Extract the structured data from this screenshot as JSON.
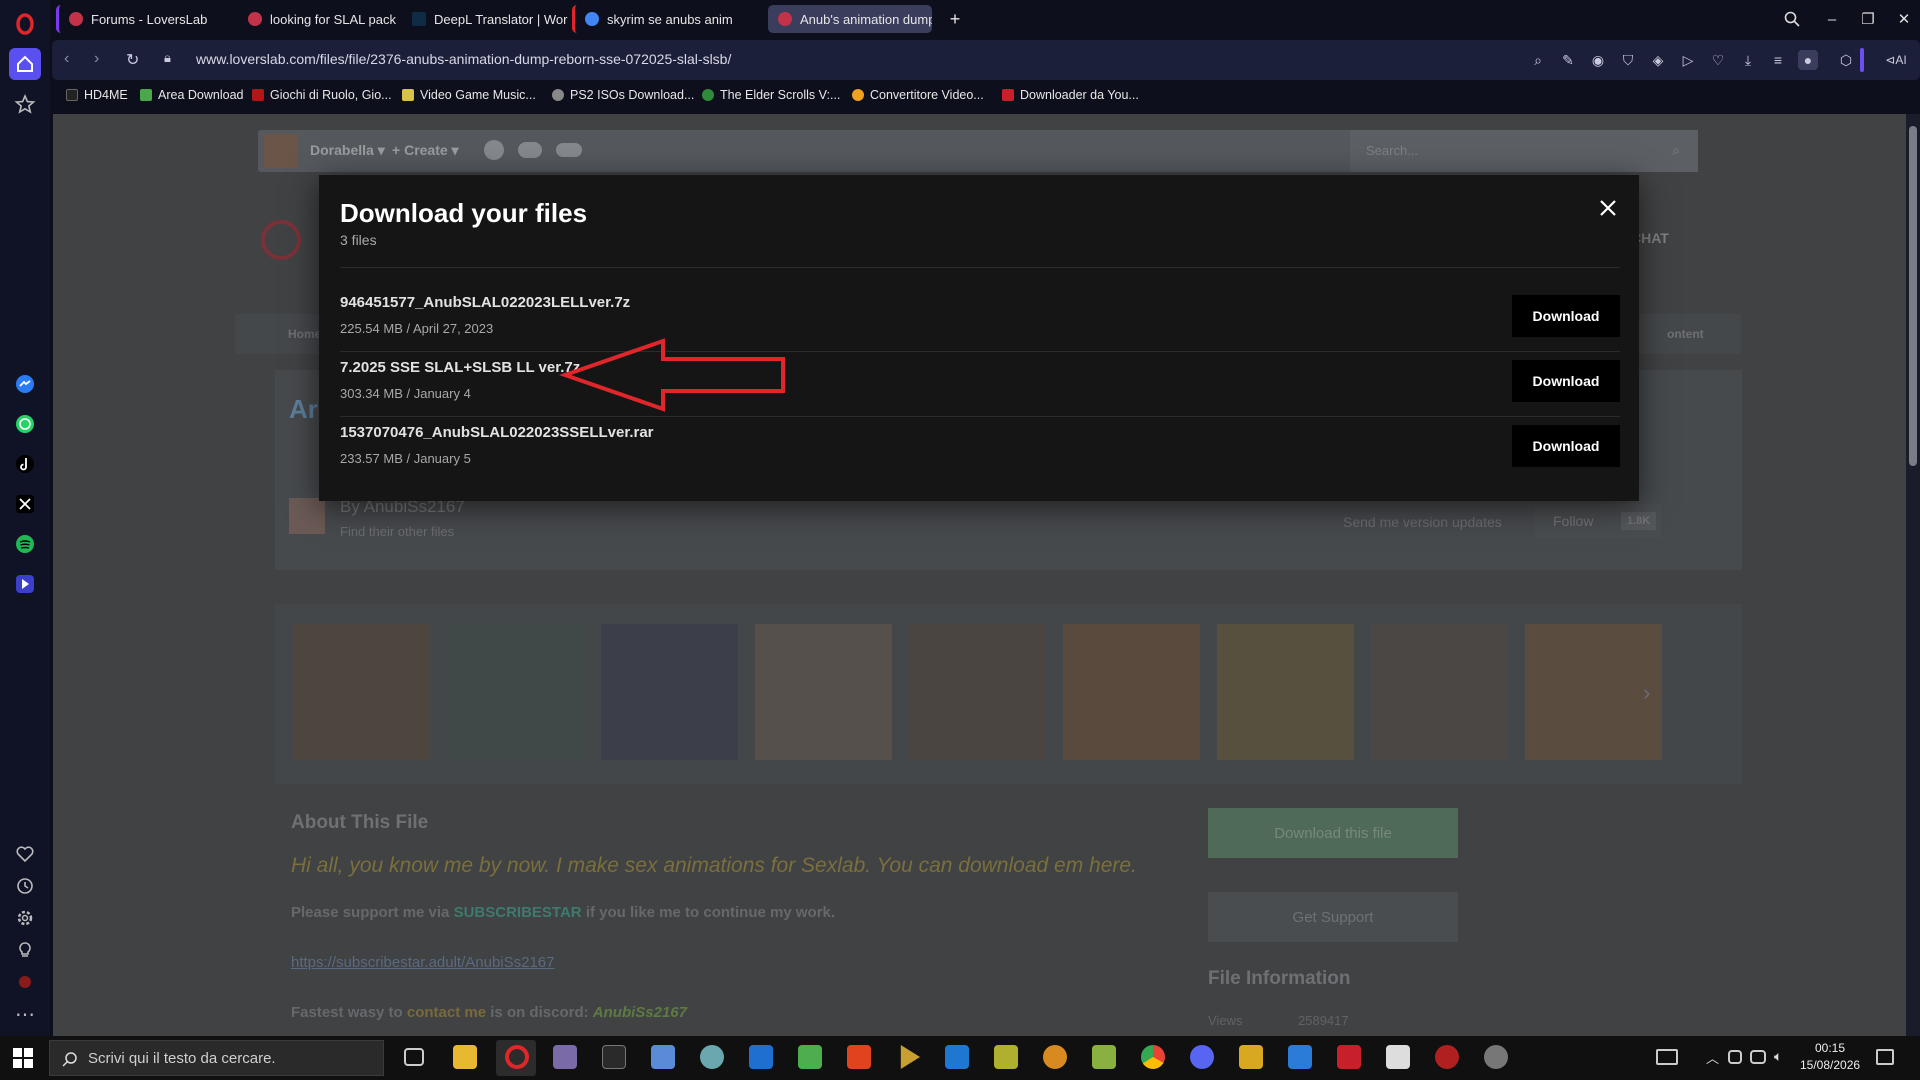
{
  "browser": {
    "tabs": [
      {
        "label": "Forums - LoversLab",
        "active": false
      },
      {
        "label": "looking for SLAL pack con",
        "active": false
      },
      {
        "label": "DeepL Translator | World's",
        "active": false
      },
      {
        "label": "skyrim se anubs animation",
        "active": false
      },
      {
        "label": "Anub's animation dump (",
        "active": true
      }
    ],
    "new_tab": "+",
    "url": "www.loverslab.com/files/file/2376-anubs-animation-dump-reborn-sse-072025-slal-slsb/",
    "ai_label": "AI",
    "bookmarks": [
      "HD4ME",
      "Area Download",
      "Giochi di Ruolo, Gio...",
      "Video Game Music...",
      "PS2 ISOs Download...",
      "The Elder Scrolls V:...",
      "Convertitore Video...",
      "Downloader da You..."
    ]
  },
  "site": {
    "user": "Dorabella",
    "create_label": "Create",
    "search_placeholder": "Search...",
    "chat_label": "CHAT",
    "breadcrumb_home": "Home",
    "content_label": "ontent",
    "title_fragment": "Ar",
    "author": "By AnubiSs2167",
    "author_sub": "Find their other files",
    "version_updates": "Send me version updates",
    "follow_label": "Follow",
    "follow_count": "1.8K",
    "about_title": "About This File",
    "about_lead": "Hi all, you know me by now. I make sex animations for Sexlab. You can download em here.",
    "support_pre": "Please support me via",
    "support_link": "SUBSCRIBESTAR",
    "support_post": "if you like me to continue my work.",
    "subscribestar_url": "https://subscribestar.adult/AnubiSs2167",
    "discord_pre": "Fastest wasy to",
    "discord_link": "contact me",
    "discord_mid": "is on discord:",
    "discord_handle": "AnubiSs2167",
    "download_this_file": "Download this file",
    "get_support": "Get Support",
    "file_info_title": "File Information",
    "views_label": "Views",
    "views_value": "2589417"
  },
  "modal": {
    "title": "Download your files",
    "count": "3 files",
    "files": [
      {
        "name": "946451577_AnubSLAL022023LELLver.7z",
        "meta": "225.54 MB / April 27, 2023",
        "button": "Download"
      },
      {
        "name": "7.2025 SSE SLAL+SLSB LL ver.7z",
        "meta": "303.34 MB / January 4",
        "button": "Download"
      },
      {
        "name": "1537070476_AnubSLAL022023SSELLver.rar",
        "meta": "233.57 MB / January 5",
        "button": "Download"
      }
    ],
    "annotation_arrow_color": "#e0262b"
  },
  "taskbar": {
    "search_placeholder": "Scrivi qui il testo da cercare.",
    "time": "00:15",
    "date": "15/08/2026"
  },
  "colors": {
    "opera_red": "#e0262b",
    "accent_green": "#5fa37a",
    "link_yellow": "#c8b24a"
  }
}
